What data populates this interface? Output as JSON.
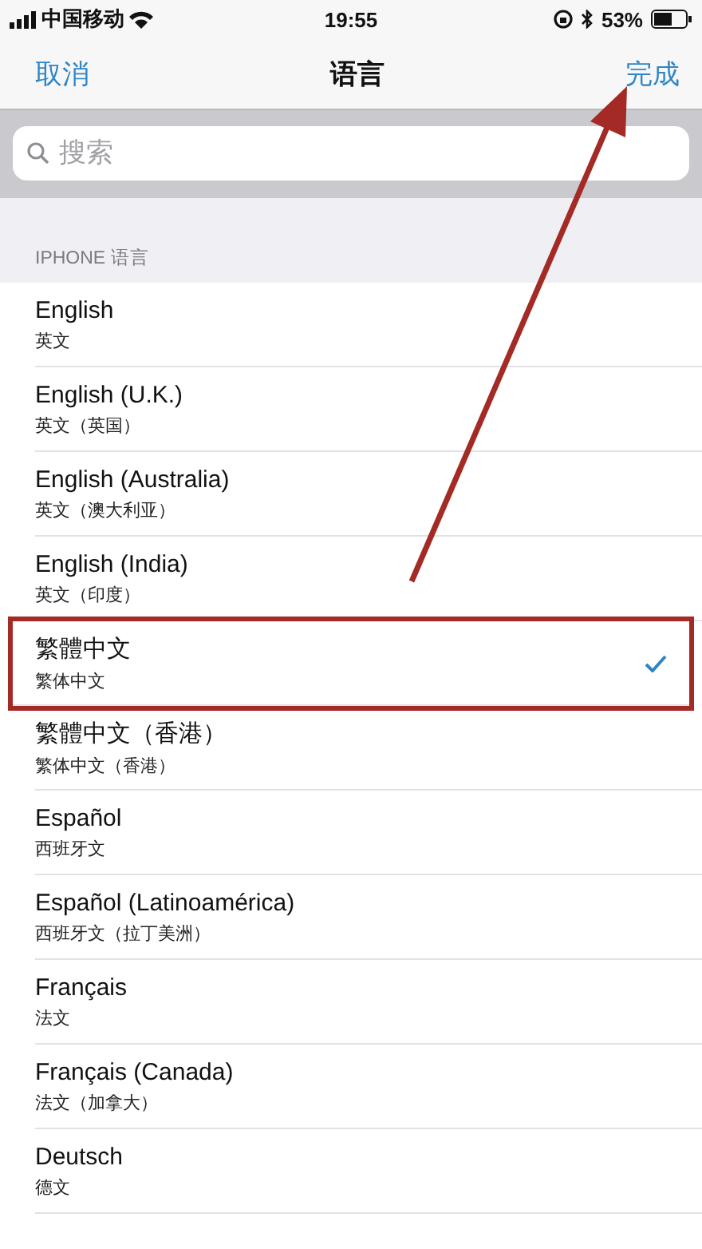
{
  "status_bar": {
    "carrier": "中国移动",
    "time": "19:55",
    "battery": "53%"
  },
  "nav": {
    "cancel": "取消",
    "title": "语言",
    "done": "完成"
  },
  "search": {
    "placeholder": "搜索"
  },
  "section_header": "IPHONE 语言",
  "languages": [
    {
      "name": "English",
      "native": "英文",
      "selected": false,
      "highlighted": false
    },
    {
      "name": "English (U.K.)",
      "native": "英文（英国）",
      "selected": false,
      "highlighted": false
    },
    {
      "name": "English (Australia)",
      "native": "英文（澳大利亚）",
      "selected": false,
      "highlighted": false
    },
    {
      "name": "English (India)",
      "native": "英文（印度）",
      "selected": false,
      "highlighted": false
    },
    {
      "name": "繁體中文",
      "native": "繁体中文",
      "selected": true,
      "highlighted": true
    },
    {
      "name": "繁體中文（香港）",
      "native": "繁体中文（香港）",
      "selected": false,
      "highlighted": false
    },
    {
      "name": "Español",
      "native": "西班牙文",
      "selected": false,
      "highlighted": false
    },
    {
      "name": "Español (Latinoamérica)",
      "native": "西班牙文（拉丁美洲）",
      "selected": false,
      "highlighted": false
    },
    {
      "name": "Français",
      "native": "法文",
      "selected": false,
      "highlighted": false
    },
    {
      "name": "Français (Canada)",
      "native": "法文（加拿大）",
      "selected": false,
      "highlighted": false
    },
    {
      "name": "Deutsch",
      "native": "德文",
      "selected": false,
      "highlighted": false
    }
  ]
}
